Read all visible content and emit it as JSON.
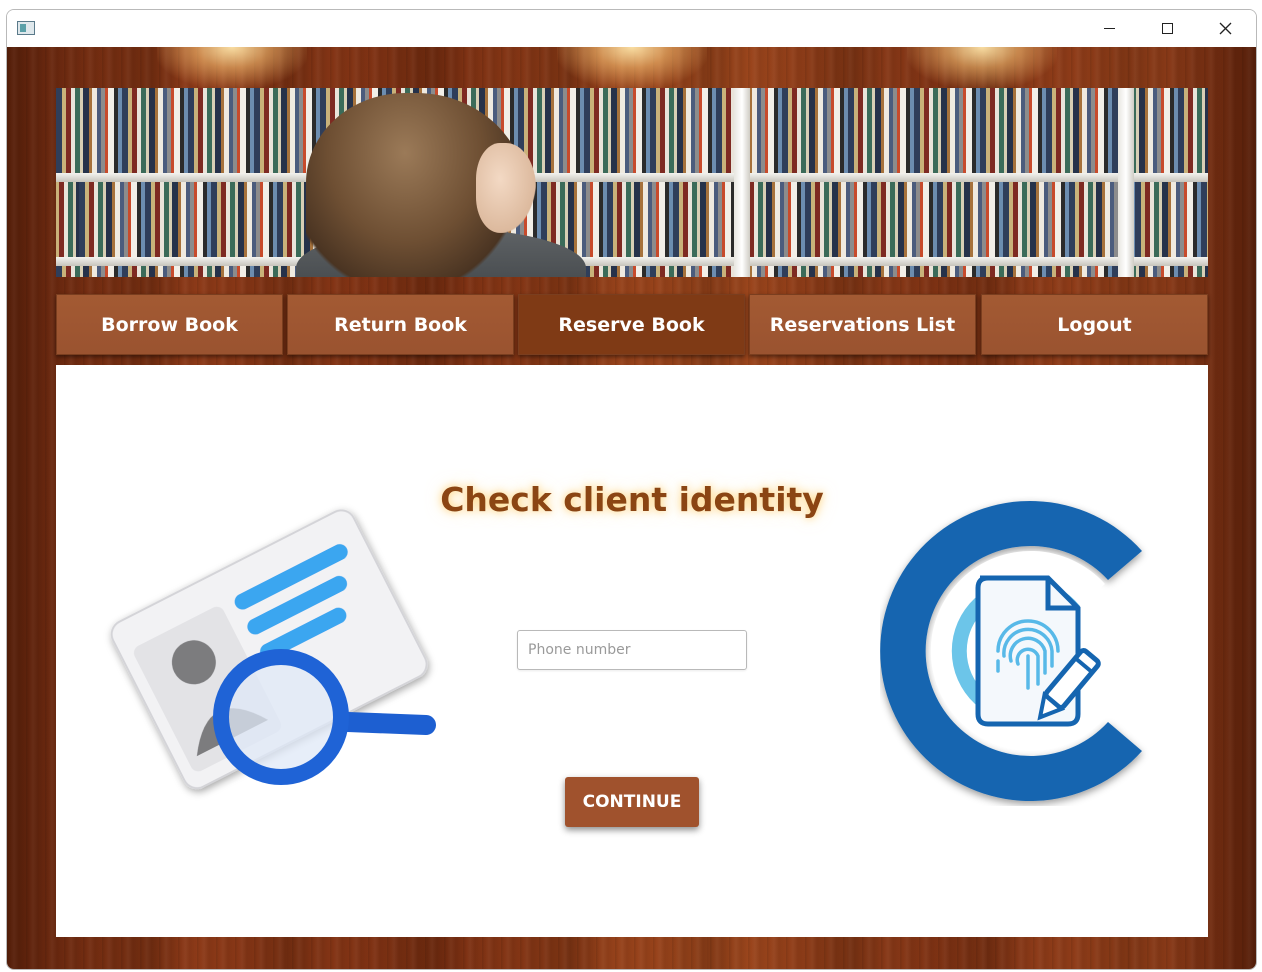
{
  "window": {
    "controls": {
      "minimize_icon": "minimize-icon",
      "maximize_icon": "maximize-icon",
      "close_icon": "close-icon"
    }
  },
  "nav": {
    "items": [
      {
        "label": "Borrow Book",
        "active": false
      },
      {
        "label": "Return Book",
        "active": false
      },
      {
        "label": "Reserve Book",
        "active": true
      },
      {
        "label": "Reservations List",
        "active": false
      },
      {
        "label": "Logout",
        "active": false
      }
    ]
  },
  "main": {
    "heading": "Check client identity",
    "phone_placeholder": "Phone number",
    "phone_value": "",
    "continue_label": "CONTINUE"
  },
  "colors": {
    "nav_button": "#a35a33",
    "nav_button_active": "#7f3a15",
    "heading": "#8b4513",
    "continue_button": "#a0522d",
    "wood": "#8d3a18"
  }
}
